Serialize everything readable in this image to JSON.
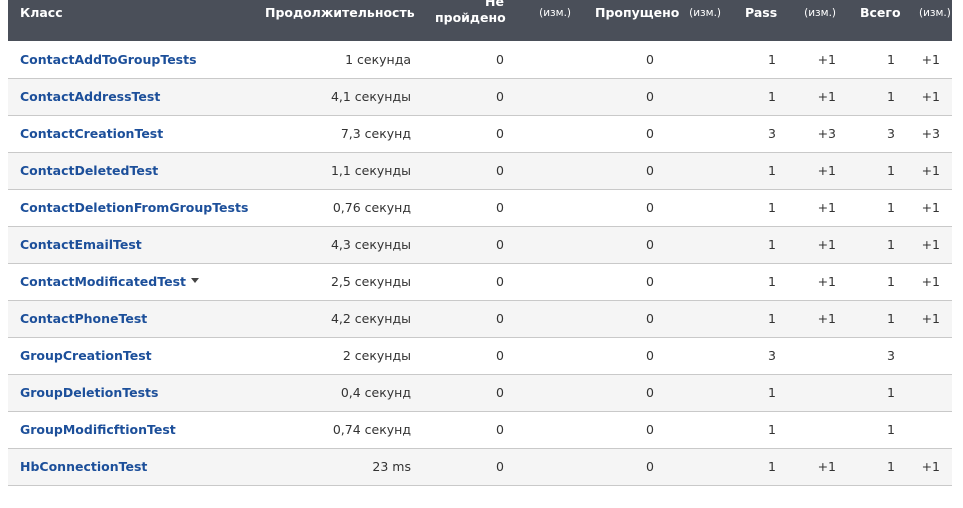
{
  "headers": {
    "class": "Класс",
    "duration": "Продолжительность",
    "failed": "Не\nпройдено",
    "failed_line1": "Не",
    "failed_line2": "пройдено",
    "failed_diff": "(изм.)",
    "skipped": "Пропущено",
    "skipped_diff": "(изм.)",
    "pass": "Pass",
    "pass_diff": "(изм.)",
    "total": "Всего",
    "total_diff": "(изм.)"
  },
  "rows": [
    {
      "name": "ContactAddToGroupTests",
      "duration": "1 секунда",
      "failed": "0",
      "failed_diff": "",
      "skipped": "0",
      "skipped_diff": "",
      "pass": "1",
      "pass_diff": "+1",
      "total": "1",
      "total_diff": "+1"
    },
    {
      "name": "ContactAddressTest",
      "duration": "4,1 секунды",
      "failed": "0",
      "failed_diff": "",
      "skipped": "0",
      "skipped_diff": "",
      "pass": "1",
      "pass_diff": "+1",
      "total": "1",
      "total_diff": "+1"
    },
    {
      "name": "ContactCreationTest",
      "duration": "7,3 секунд",
      "failed": "0",
      "failed_diff": "",
      "skipped": "0",
      "skipped_diff": "",
      "pass": "3",
      "pass_diff": "+3",
      "total": "3",
      "total_diff": "+3"
    },
    {
      "name": "ContactDeletedTest",
      "duration": "1,1 секунды",
      "failed": "0",
      "failed_diff": "",
      "skipped": "0",
      "skipped_diff": "",
      "pass": "1",
      "pass_diff": "+1",
      "total": "1",
      "total_diff": "+1"
    },
    {
      "name": "ContactDeletionFromGroupTests",
      "duration": "0,76 секунд",
      "failed": "0",
      "failed_diff": "",
      "skipped": "0",
      "skipped_diff": "",
      "pass": "1",
      "pass_diff": "+1",
      "total": "1",
      "total_diff": "+1"
    },
    {
      "name": "ContactEmailTest",
      "duration": "4,3 секунды",
      "failed": "0",
      "failed_diff": "",
      "skipped": "0",
      "skipped_diff": "",
      "pass": "1",
      "pass_diff": "+1",
      "total": "1",
      "total_diff": "+1"
    },
    {
      "name": "ContactModificatedTest",
      "duration": "2,5 секунды",
      "failed": "0",
      "failed_diff": "",
      "skipped": "0",
      "skipped_diff": "",
      "pass": "1",
      "pass_diff": "+1",
      "total": "1",
      "total_diff": "+1",
      "has_menu": true
    },
    {
      "name": "ContactPhoneTest",
      "duration": "4,2 секунды",
      "failed": "0",
      "failed_diff": "",
      "skipped": "0",
      "skipped_diff": "",
      "pass": "1",
      "pass_diff": "+1",
      "total": "1",
      "total_diff": "+1"
    },
    {
      "name": "GroupCreationTest",
      "duration": "2 секунды",
      "failed": "0",
      "failed_diff": "",
      "skipped": "0",
      "skipped_diff": "",
      "pass": "3",
      "pass_diff": "",
      "total": "3",
      "total_diff": ""
    },
    {
      "name": "GroupDeletionTests",
      "duration": "0,4 секунд",
      "failed": "0",
      "failed_diff": "",
      "skipped": "0",
      "skipped_diff": "",
      "pass": "1",
      "pass_diff": "",
      "total": "1",
      "total_diff": ""
    },
    {
      "name": "GroupModificftionTest",
      "duration": "0,74 секунд",
      "failed": "0",
      "failed_diff": "",
      "skipped": "0",
      "skipped_diff": "",
      "pass": "1",
      "pass_diff": "",
      "total": "1",
      "total_diff": ""
    },
    {
      "name": "HbConnectionTest",
      "duration": "23 ms",
      "failed": "0",
      "failed_diff": "",
      "skipped": "0",
      "skipped_diff": "",
      "pass": "1",
      "pass_diff": "+1",
      "total": "1",
      "total_diff": "+1"
    }
  ],
  "icons": {
    "row_menu": "chevron-down-icon"
  }
}
